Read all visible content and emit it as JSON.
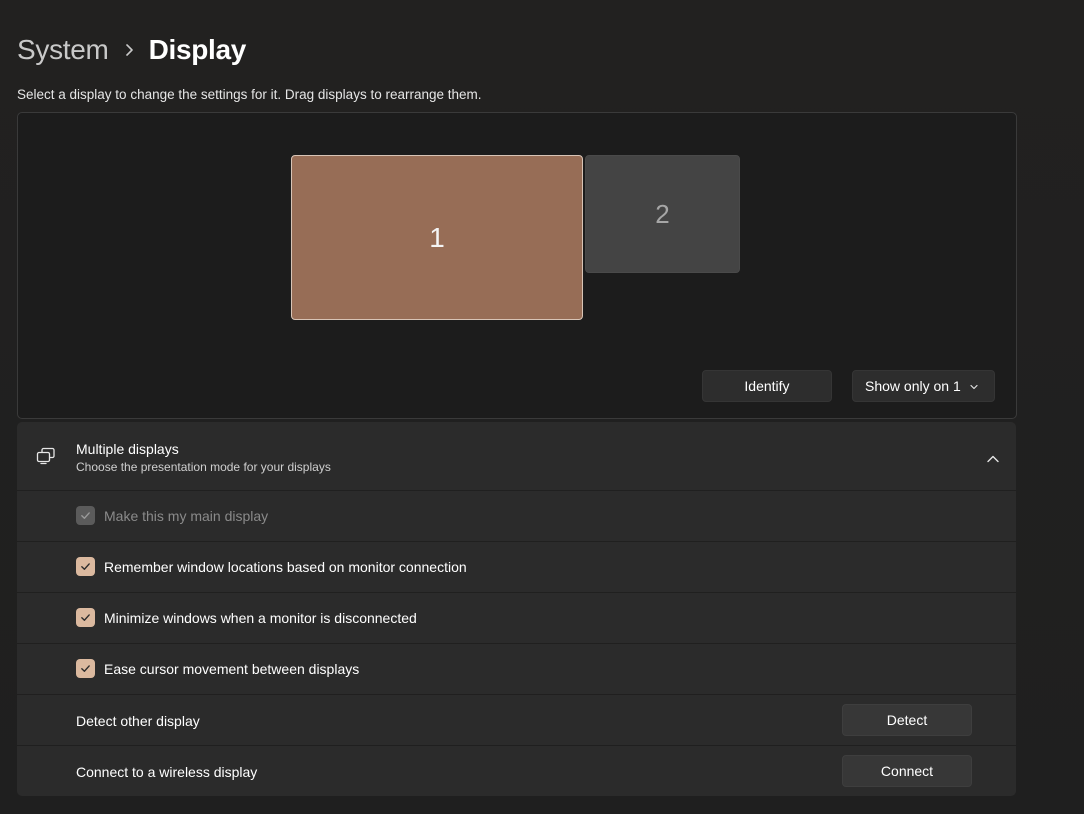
{
  "breadcrumb": {
    "parent": "System",
    "separator_icon": "chevron-right-icon",
    "current": "Display"
  },
  "arrange": {
    "instruction": "Select a display to change the settings for it. Drag displays to rearrange them.",
    "monitors": [
      {
        "label": "1",
        "selected": true
      },
      {
        "label": "2",
        "selected": false
      }
    ],
    "identify_label": "Identify",
    "show_only_value": "Show only on 1"
  },
  "multiple_displays": {
    "icon": "multiple-displays-icon",
    "title": "Multiple displays",
    "subtitle": "Choose the presentation mode for your displays",
    "expanded": true,
    "options": [
      {
        "label": "Make this my main display",
        "checked": true,
        "disabled": true
      },
      {
        "label": "Remember window locations based on monitor connection",
        "checked": true,
        "disabled": false
      },
      {
        "label": "Minimize windows when a monitor is disconnected",
        "checked": true,
        "disabled": false
      },
      {
        "label": "Ease cursor movement between displays",
        "checked": true,
        "disabled": false
      }
    ],
    "detect": {
      "label": "Detect other display",
      "button": "Detect"
    },
    "connect": {
      "label": "Connect to a wireless display",
      "button": "Connect"
    }
  },
  "colors": {
    "accent": "#dbb99f",
    "selected_monitor": "#976d56",
    "unselected_monitor": "#444444",
    "card_background": "#2b2b2b"
  }
}
